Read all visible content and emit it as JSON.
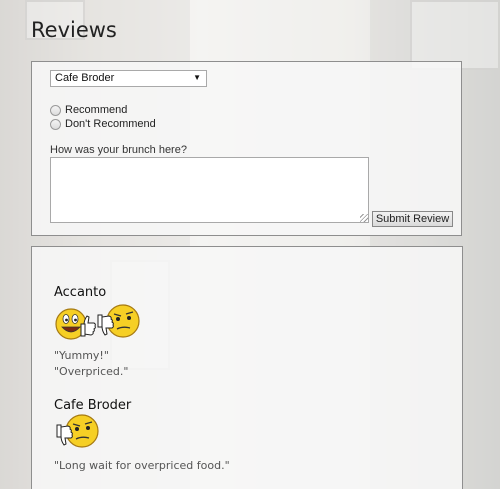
{
  "page": {
    "title": "Reviews"
  },
  "form": {
    "restaurant_select": {
      "selected": "Cafe Broder"
    },
    "options": {
      "recommend": "Recommend",
      "dont_recommend": "Don't Recommend"
    },
    "question": "How was your brunch here?",
    "comment_value": "",
    "submit_label": "Submit Review"
  },
  "reviews": [
    {
      "name": "Accanto",
      "icons": [
        "thumbs-up-smiley-icon",
        "thumbs-down-unsure-smiley-icon"
      ],
      "quotes": [
        "\"Yummy!\"",
        "\"Overpriced.\""
      ]
    },
    {
      "name": "Cafe Broder",
      "icons": [
        "thumbs-down-unsure-smiley-icon"
      ],
      "quotes": [
        "\"Long wait for overpriced food.\""
      ]
    }
  ],
  "colors": {
    "emoji_yellow": "#f6cf25",
    "emoji_outline": "#a67a12"
  }
}
